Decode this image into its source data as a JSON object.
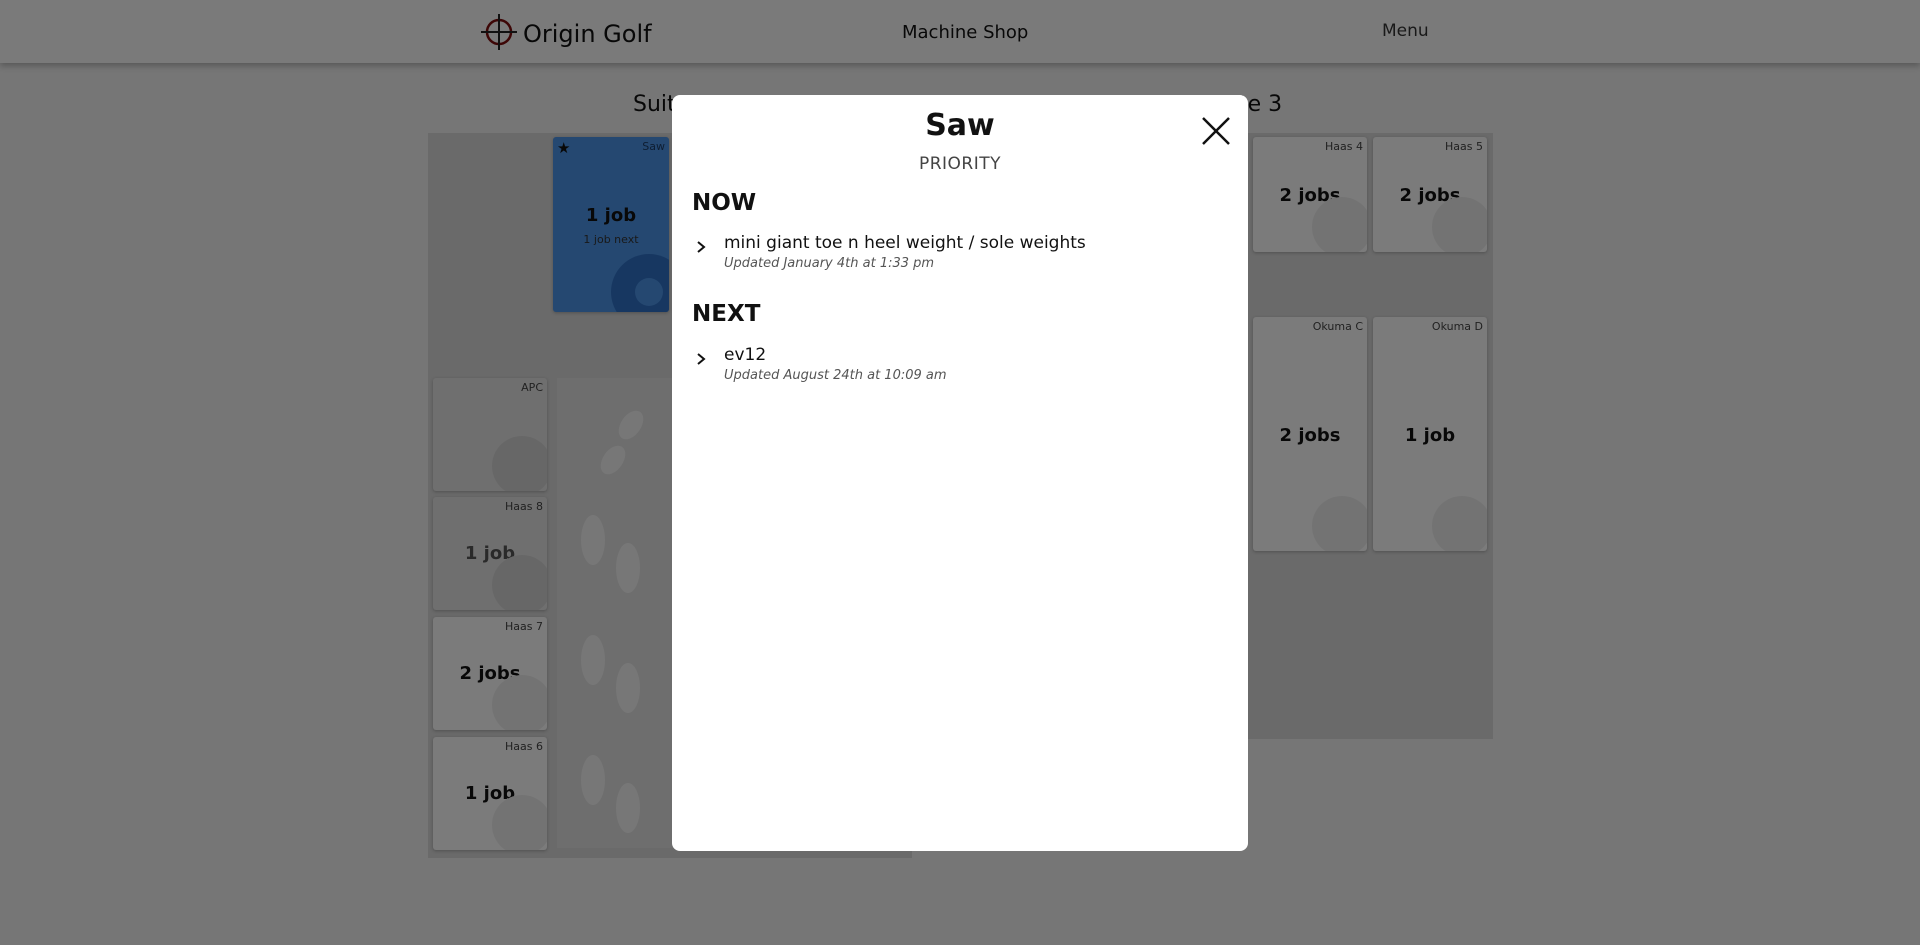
{
  "header": {
    "brand": "Origin Golf",
    "title": "Machine Shop",
    "menu": "Menu"
  },
  "floor": {
    "suite_left_visible": "Suit",
    "suite_right_visible": "te 3",
    "machines": {
      "saw": {
        "name": "Saw",
        "jobs": "1 job",
        "next": "1 job next"
      },
      "apc": {
        "name": "APC"
      },
      "haas8": {
        "name": "Haas 8",
        "jobs": "1 job"
      },
      "haas7": {
        "name": "Haas 7",
        "jobs": "2 jobs"
      },
      "haas6": {
        "name": "Haas 6",
        "jobs": "1 job"
      },
      "haas4": {
        "name": "Haas 4",
        "jobs": "2 jobs"
      },
      "haas5": {
        "name": "Haas 5",
        "jobs": "2 jobs"
      },
      "okumaC": {
        "name": "Okuma C",
        "jobs": "2 jobs"
      },
      "okumaD": {
        "name": "Okuma D",
        "jobs": "1 job"
      }
    }
  },
  "modal": {
    "title": "Saw",
    "subtitle": "PRIORITY",
    "sections": [
      {
        "heading": "NOW",
        "items": [
          {
            "title": "mini giant toe n heel weight / sole weights",
            "updated": "Updated January 4th at 1:33 pm"
          }
        ]
      },
      {
        "heading": "NEXT",
        "items": [
          {
            "title": "ev12",
            "updated": "Updated August 24th at 10:09 am"
          }
        ]
      }
    ]
  },
  "colors": {
    "active_card": "#4a90e2",
    "overlay": "rgba(0,0,0,0.5)"
  },
  "icons": {
    "logo": "crosshair-icon",
    "close": "close-icon",
    "chevron": "chevron-right-icon",
    "machine": "gear-icon",
    "walkway": "footprints-icon",
    "priority": "star-icon"
  }
}
